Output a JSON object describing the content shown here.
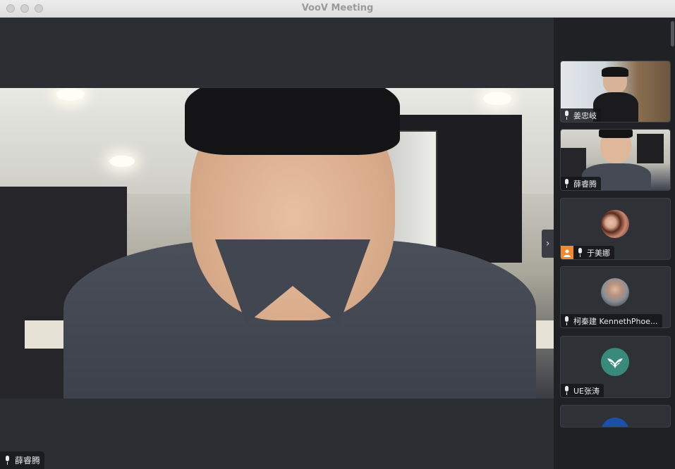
{
  "window": {
    "title": "VooV Meeting"
  },
  "main": {
    "speaker_name": "薛睿腾",
    "next_arrow": "›"
  },
  "participants": [
    {
      "name": "姜忠岐",
      "video": true
    },
    {
      "name": "薛睿腾",
      "video": true
    },
    {
      "name": "于美娜",
      "video": false,
      "host": true
    },
    {
      "name": "柯秦建 KennethPhoe...",
      "video": false
    },
    {
      "name": "UE张涛",
      "video": false
    }
  ],
  "colors": {
    "panel_bg": "#1f2125",
    "stage_bg": "#2b2e33",
    "host_badge": "#f08a30",
    "avatar_teal": "#3a8a7c",
    "avatar_blue": "#1e4fa8"
  }
}
